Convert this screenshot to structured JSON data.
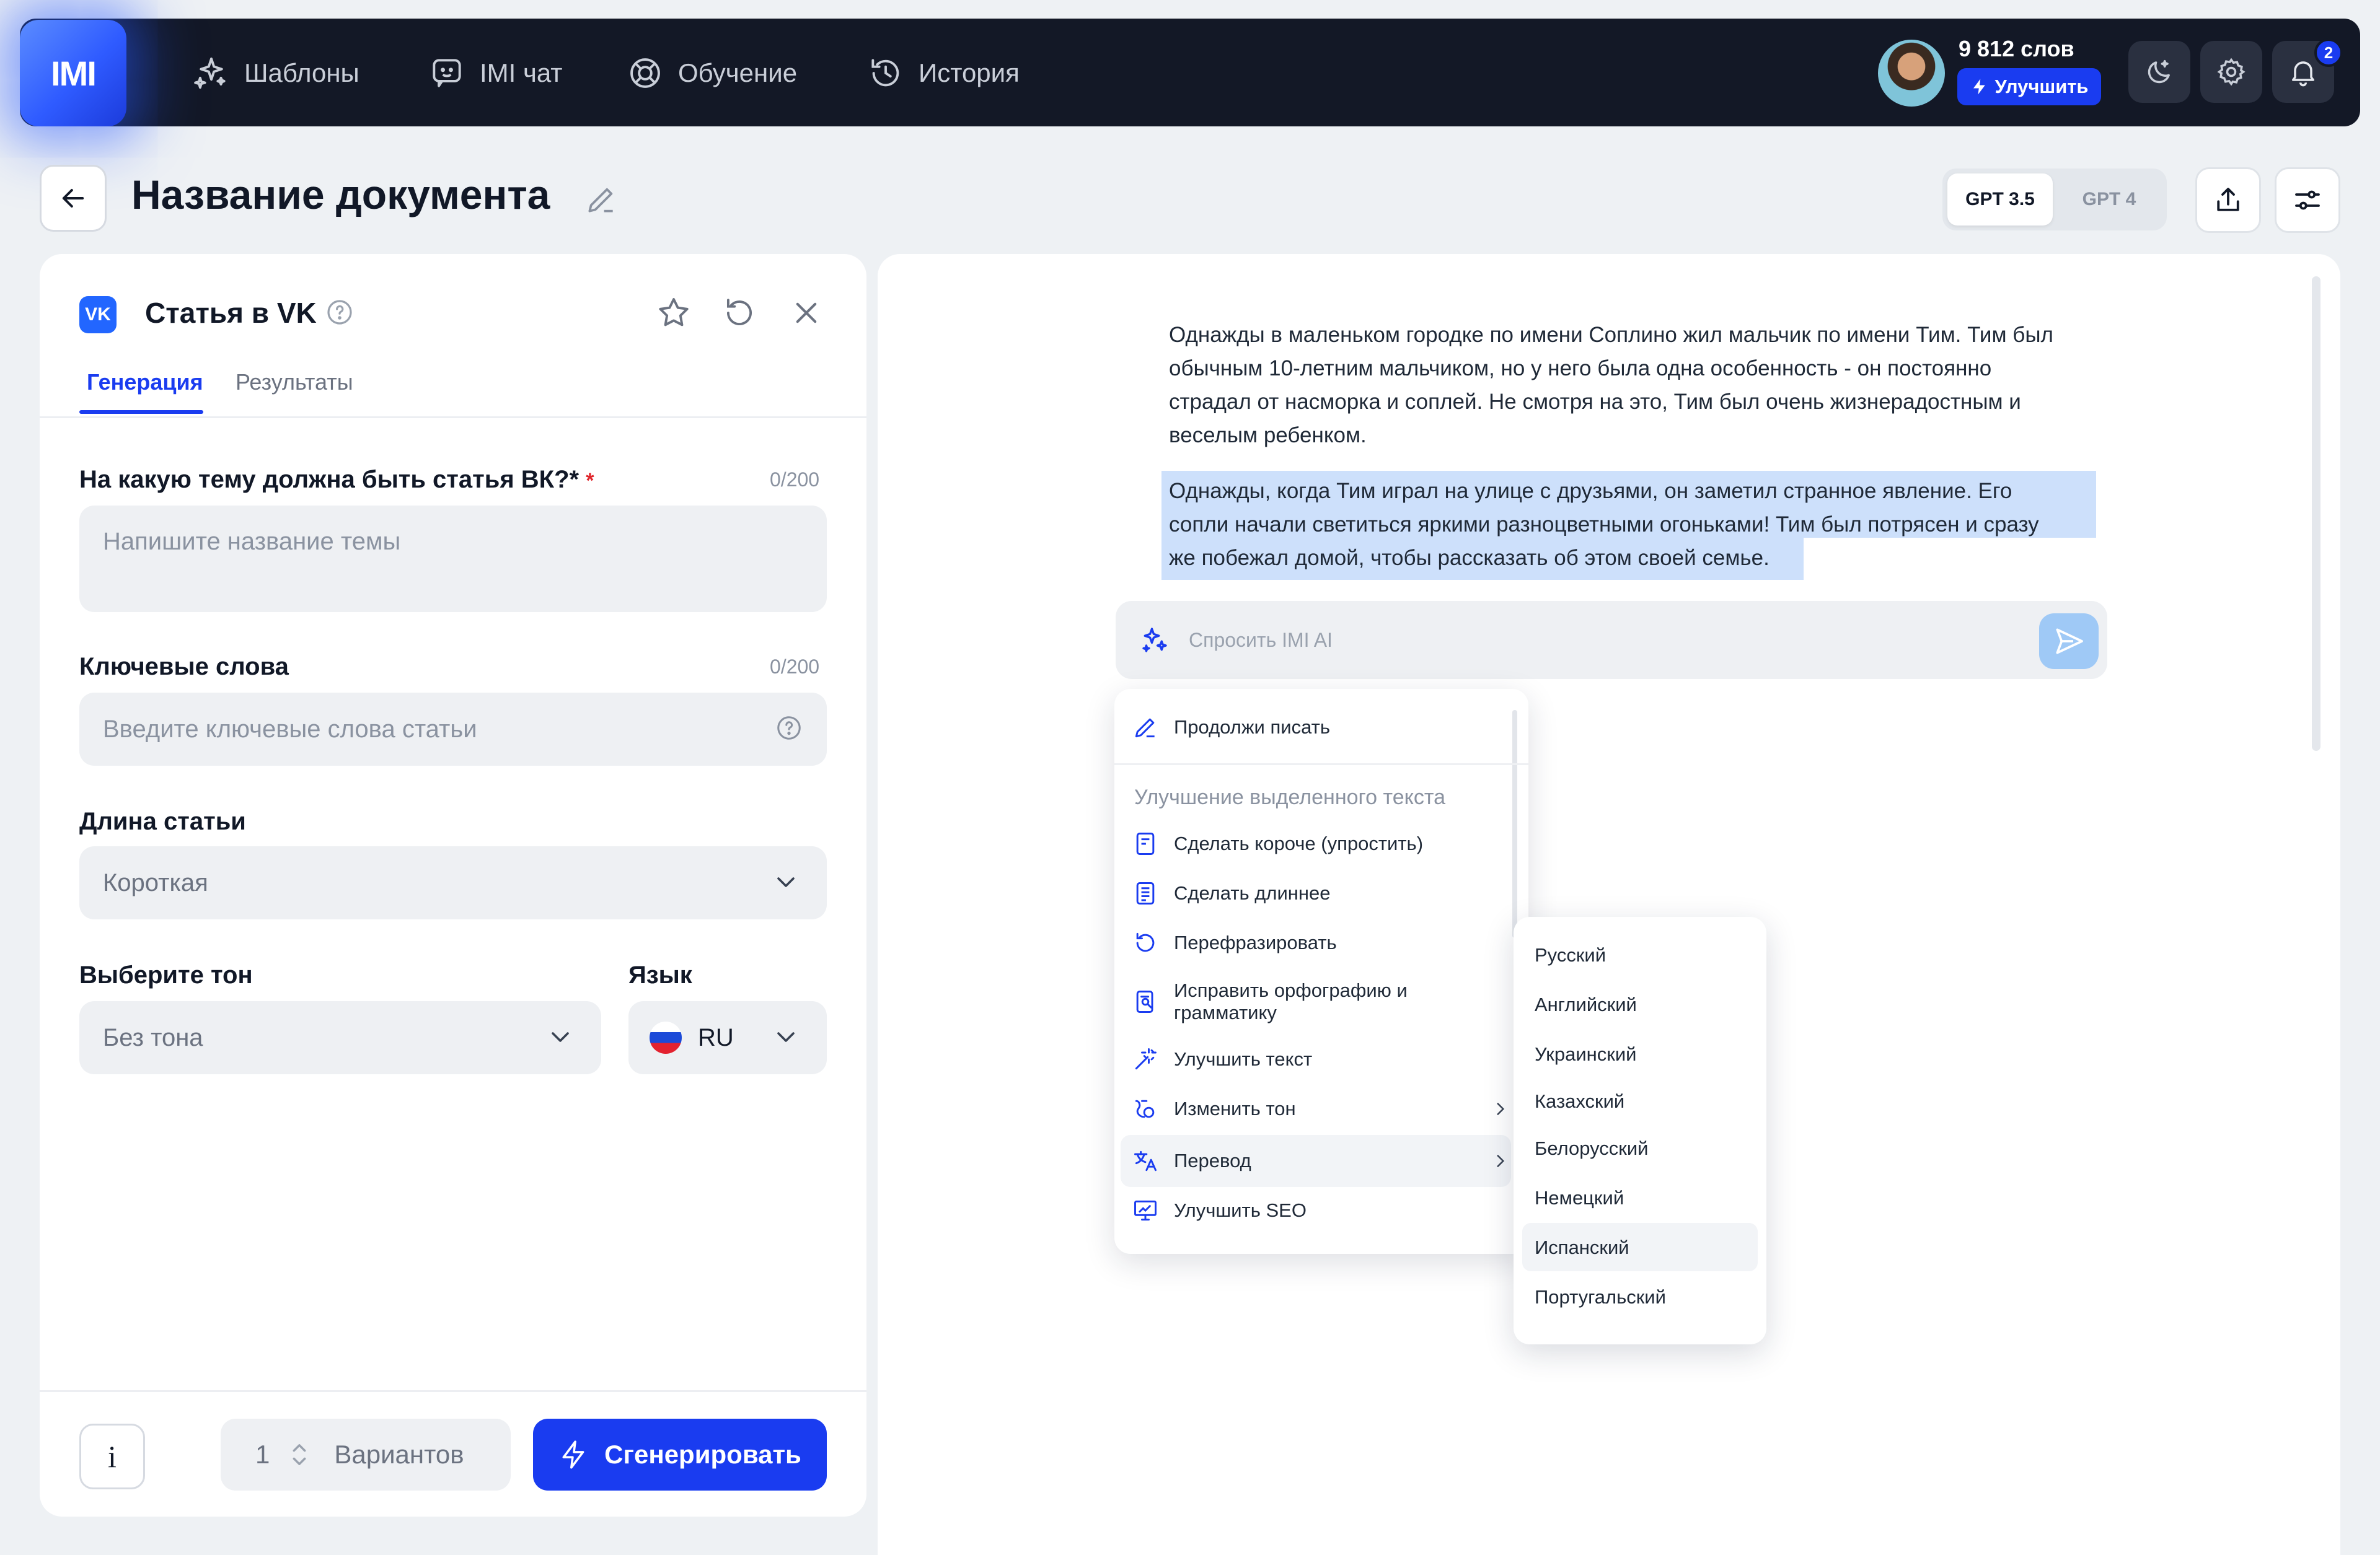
{
  "nav": {
    "logo": "IMI",
    "items": [
      {
        "label": "Шаблоны",
        "icon": "sparkles-icon"
      },
      {
        "label": "IMI чат",
        "icon": "chat-bot-icon"
      },
      {
        "label": "Обучение",
        "icon": "lifebuoy-icon"
      },
      {
        "label": "История",
        "icon": "history-icon"
      }
    ],
    "words_count": "9 812 слов",
    "upgrade_label": "Улучшить",
    "notifications_count": "2"
  },
  "header": {
    "title": "Название документа",
    "model_options": [
      "GPT 3.5",
      "GPT 4"
    ],
    "model_selected": "GPT 3.5"
  },
  "form": {
    "template_title": "Статья в VK",
    "template_logo": "VK",
    "tabs": [
      "Генерация",
      "Результаты"
    ],
    "active_tab": "Генерация",
    "topic": {
      "label": "На какую тему должна быть статья ВК?*",
      "required_mark": "*",
      "counter": "0/200",
      "placeholder": "Напишите название темы"
    },
    "keywords": {
      "label": "Ключевые слова",
      "counter": "0/200",
      "placeholder": "Введите ключевые слова статьи"
    },
    "length": {
      "label": "Длина статьи",
      "value": "Короткая"
    },
    "tone": {
      "label": "Выберите тон",
      "value": "Без тона"
    },
    "language": {
      "label": "Язык",
      "value": "RU"
    },
    "info_label": "i",
    "variants_count": "1",
    "variants_label": "Вариантов",
    "generate_label": "Сгенерировать"
  },
  "editor": {
    "paragraph1": [
      "Однажды в маленьком городке по имени Соплино жил мальчик по имени Тим. Тим был",
      "обычным 10-летним мальчиком, но у него была одна особенность - он постоянно",
      "страдал от насморка и соплей. Не смотря на это, Тим был очень жизнерадостным и",
      "веселым ребенком."
    ],
    "paragraph2_selected": [
      "Однажды, когда Тим играл на улице с друзьями, он заметил странное явление. Его",
      "сопли начали светиться яркими разноцветными огоньками! Тим был потрясен и сразу",
      "же побежал домой, чтобы рассказать об этом своей семье."
    ],
    "ask_placeholder": "Спросить IMI AI"
  },
  "menu": {
    "continue_label": "Продолжи писать",
    "section_heading": "Улучшение выделенного текста",
    "items": [
      {
        "label": "Сделать короче (упростить)",
        "icon": "doc-short-icon"
      },
      {
        "label": "Сделать длиннее",
        "icon": "doc-long-icon"
      },
      {
        "label": "Перефразировать",
        "icon": "rephrase-icon"
      },
      {
        "label": "Исправить орфографию и",
        "label2": "грамматику",
        "icon": "spellcheck-icon"
      },
      {
        "label": "Улучшить текст",
        "icon": "magic-wand-icon"
      },
      {
        "label": "Изменить тон",
        "icon": "tone-icon"
      },
      {
        "label": "Перевод",
        "icon": "translate-icon"
      },
      {
        "label": "Улучшить SEO",
        "icon": "seo-icon"
      }
    ],
    "active_item": "Перевод"
  },
  "submenu": {
    "languages": [
      "Русский",
      "Английский",
      "Украинский",
      "Казахский",
      "Белорусский",
      "Немецкий",
      "Испанский",
      "Португальский"
    ],
    "hovered": "Испанский"
  },
  "colors": {
    "accent": "#1a3cf0",
    "nav_bg": "#131826",
    "selection": "#cde0fb",
    "page_bg": "#eef1f4"
  }
}
